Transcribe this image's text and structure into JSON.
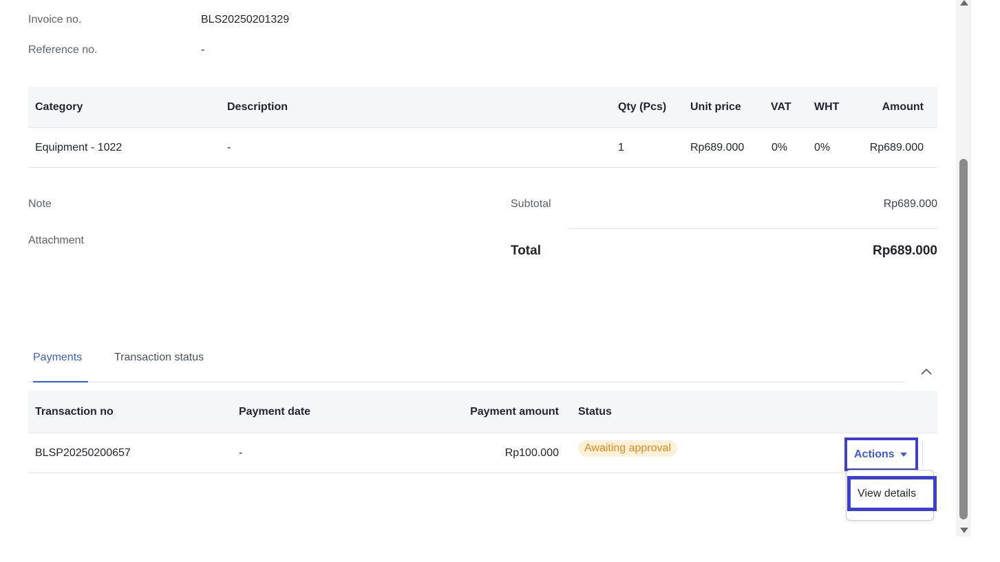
{
  "invoice": {
    "invoice_no_label": "Invoice no.",
    "invoice_no_value": "BLS20250201329",
    "reference_no_label": "Reference no.",
    "reference_no_value": "-"
  },
  "items_table": {
    "headers": {
      "category": "Category",
      "description": "Description",
      "qty": "Qty (Pcs)",
      "unit_price": "Unit price",
      "vat": "VAT",
      "wht": "WHT",
      "amount": "Amount"
    },
    "rows": [
      {
        "category": "Equipment - 1022",
        "description": "-",
        "qty": "1",
        "unit_price": "Rp689.000",
        "vat": "0%",
        "wht": "0%",
        "amount": "Rp689.000"
      }
    ]
  },
  "notes": {
    "note_label": "Note",
    "attachment_label": "Attachment"
  },
  "summary": {
    "subtotal_label": "Subtotal",
    "subtotal_value": "Rp689.000",
    "total_label": "Total",
    "total_value": "Rp689.000"
  },
  "tabs": {
    "payments": "Payments",
    "transaction_status": "Transaction status",
    "active": "payments"
  },
  "payments_table": {
    "headers": {
      "transaction_no": "Transaction no",
      "payment_date": "Payment date",
      "payment_amount": "Payment amount",
      "status": "Status"
    },
    "rows": [
      {
        "transaction_no": "BLSP20250200657",
        "payment_date": "-",
        "payment_amount": "Rp100.000",
        "status": "Awaiting approval"
      }
    ]
  },
  "actions": {
    "button_label": "Actions",
    "menu_items": [
      "View details"
    ]
  },
  "icons": {
    "collapse": "chevron-up-icon",
    "actions_caret": "caret-down-icon"
  },
  "colors": {
    "accent": "#3b5bd9",
    "highlight_border": "#3b3fd6",
    "status_badge_bg": "#fdf0d9",
    "status_badge_text": "#e08a1a"
  }
}
